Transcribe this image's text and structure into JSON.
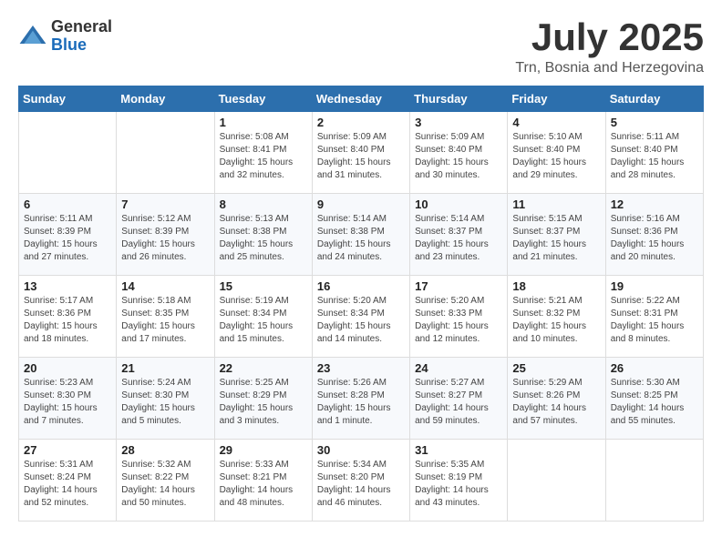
{
  "logo": {
    "general": "General",
    "blue": "Blue"
  },
  "title": {
    "month": "July 2025",
    "location": "Trn, Bosnia and Herzegovina"
  },
  "weekdays": [
    "Sunday",
    "Monday",
    "Tuesday",
    "Wednesday",
    "Thursday",
    "Friday",
    "Saturday"
  ],
  "weeks": [
    [
      {
        "day": "",
        "sunrise": "",
        "sunset": "",
        "daylight": ""
      },
      {
        "day": "",
        "sunrise": "",
        "sunset": "",
        "daylight": ""
      },
      {
        "day": "1",
        "sunrise": "Sunrise: 5:08 AM",
        "sunset": "Sunset: 8:41 PM",
        "daylight": "Daylight: 15 hours and 32 minutes."
      },
      {
        "day": "2",
        "sunrise": "Sunrise: 5:09 AM",
        "sunset": "Sunset: 8:40 PM",
        "daylight": "Daylight: 15 hours and 31 minutes."
      },
      {
        "day": "3",
        "sunrise": "Sunrise: 5:09 AM",
        "sunset": "Sunset: 8:40 PM",
        "daylight": "Daylight: 15 hours and 30 minutes."
      },
      {
        "day": "4",
        "sunrise": "Sunrise: 5:10 AM",
        "sunset": "Sunset: 8:40 PM",
        "daylight": "Daylight: 15 hours and 29 minutes."
      },
      {
        "day": "5",
        "sunrise": "Sunrise: 5:11 AM",
        "sunset": "Sunset: 8:40 PM",
        "daylight": "Daylight: 15 hours and 28 minutes."
      }
    ],
    [
      {
        "day": "6",
        "sunrise": "Sunrise: 5:11 AM",
        "sunset": "Sunset: 8:39 PM",
        "daylight": "Daylight: 15 hours and 27 minutes."
      },
      {
        "day": "7",
        "sunrise": "Sunrise: 5:12 AM",
        "sunset": "Sunset: 8:39 PM",
        "daylight": "Daylight: 15 hours and 26 minutes."
      },
      {
        "day": "8",
        "sunrise": "Sunrise: 5:13 AM",
        "sunset": "Sunset: 8:38 PM",
        "daylight": "Daylight: 15 hours and 25 minutes."
      },
      {
        "day": "9",
        "sunrise": "Sunrise: 5:14 AM",
        "sunset": "Sunset: 8:38 PM",
        "daylight": "Daylight: 15 hours and 24 minutes."
      },
      {
        "day": "10",
        "sunrise": "Sunrise: 5:14 AM",
        "sunset": "Sunset: 8:37 PM",
        "daylight": "Daylight: 15 hours and 23 minutes."
      },
      {
        "day": "11",
        "sunrise": "Sunrise: 5:15 AM",
        "sunset": "Sunset: 8:37 PM",
        "daylight": "Daylight: 15 hours and 21 minutes."
      },
      {
        "day": "12",
        "sunrise": "Sunrise: 5:16 AM",
        "sunset": "Sunset: 8:36 PM",
        "daylight": "Daylight: 15 hours and 20 minutes."
      }
    ],
    [
      {
        "day": "13",
        "sunrise": "Sunrise: 5:17 AM",
        "sunset": "Sunset: 8:36 PM",
        "daylight": "Daylight: 15 hours and 18 minutes."
      },
      {
        "day": "14",
        "sunrise": "Sunrise: 5:18 AM",
        "sunset": "Sunset: 8:35 PM",
        "daylight": "Daylight: 15 hours and 17 minutes."
      },
      {
        "day": "15",
        "sunrise": "Sunrise: 5:19 AM",
        "sunset": "Sunset: 8:34 PM",
        "daylight": "Daylight: 15 hours and 15 minutes."
      },
      {
        "day": "16",
        "sunrise": "Sunrise: 5:20 AM",
        "sunset": "Sunset: 8:34 PM",
        "daylight": "Daylight: 15 hours and 14 minutes."
      },
      {
        "day": "17",
        "sunrise": "Sunrise: 5:20 AM",
        "sunset": "Sunset: 8:33 PM",
        "daylight": "Daylight: 15 hours and 12 minutes."
      },
      {
        "day": "18",
        "sunrise": "Sunrise: 5:21 AM",
        "sunset": "Sunset: 8:32 PM",
        "daylight": "Daylight: 15 hours and 10 minutes."
      },
      {
        "day": "19",
        "sunrise": "Sunrise: 5:22 AM",
        "sunset": "Sunset: 8:31 PM",
        "daylight": "Daylight: 15 hours and 8 minutes."
      }
    ],
    [
      {
        "day": "20",
        "sunrise": "Sunrise: 5:23 AM",
        "sunset": "Sunset: 8:30 PM",
        "daylight": "Daylight: 15 hours and 7 minutes."
      },
      {
        "day": "21",
        "sunrise": "Sunrise: 5:24 AM",
        "sunset": "Sunset: 8:30 PM",
        "daylight": "Daylight: 15 hours and 5 minutes."
      },
      {
        "day": "22",
        "sunrise": "Sunrise: 5:25 AM",
        "sunset": "Sunset: 8:29 PM",
        "daylight": "Daylight: 15 hours and 3 minutes."
      },
      {
        "day": "23",
        "sunrise": "Sunrise: 5:26 AM",
        "sunset": "Sunset: 8:28 PM",
        "daylight": "Daylight: 15 hours and 1 minute."
      },
      {
        "day": "24",
        "sunrise": "Sunrise: 5:27 AM",
        "sunset": "Sunset: 8:27 PM",
        "daylight": "Daylight: 14 hours and 59 minutes."
      },
      {
        "day": "25",
        "sunrise": "Sunrise: 5:29 AM",
        "sunset": "Sunset: 8:26 PM",
        "daylight": "Daylight: 14 hours and 57 minutes."
      },
      {
        "day": "26",
        "sunrise": "Sunrise: 5:30 AM",
        "sunset": "Sunset: 8:25 PM",
        "daylight": "Daylight: 14 hours and 55 minutes."
      }
    ],
    [
      {
        "day": "27",
        "sunrise": "Sunrise: 5:31 AM",
        "sunset": "Sunset: 8:24 PM",
        "daylight": "Daylight: 14 hours and 52 minutes."
      },
      {
        "day": "28",
        "sunrise": "Sunrise: 5:32 AM",
        "sunset": "Sunset: 8:22 PM",
        "daylight": "Daylight: 14 hours and 50 minutes."
      },
      {
        "day": "29",
        "sunrise": "Sunrise: 5:33 AM",
        "sunset": "Sunset: 8:21 PM",
        "daylight": "Daylight: 14 hours and 48 minutes."
      },
      {
        "day": "30",
        "sunrise": "Sunrise: 5:34 AM",
        "sunset": "Sunset: 8:20 PM",
        "daylight": "Daylight: 14 hours and 46 minutes."
      },
      {
        "day": "31",
        "sunrise": "Sunrise: 5:35 AM",
        "sunset": "Sunset: 8:19 PM",
        "daylight": "Daylight: 14 hours and 43 minutes."
      },
      {
        "day": "",
        "sunrise": "",
        "sunset": "",
        "daylight": ""
      },
      {
        "day": "",
        "sunrise": "",
        "sunset": "",
        "daylight": ""
      }
    ]
  ]
}
